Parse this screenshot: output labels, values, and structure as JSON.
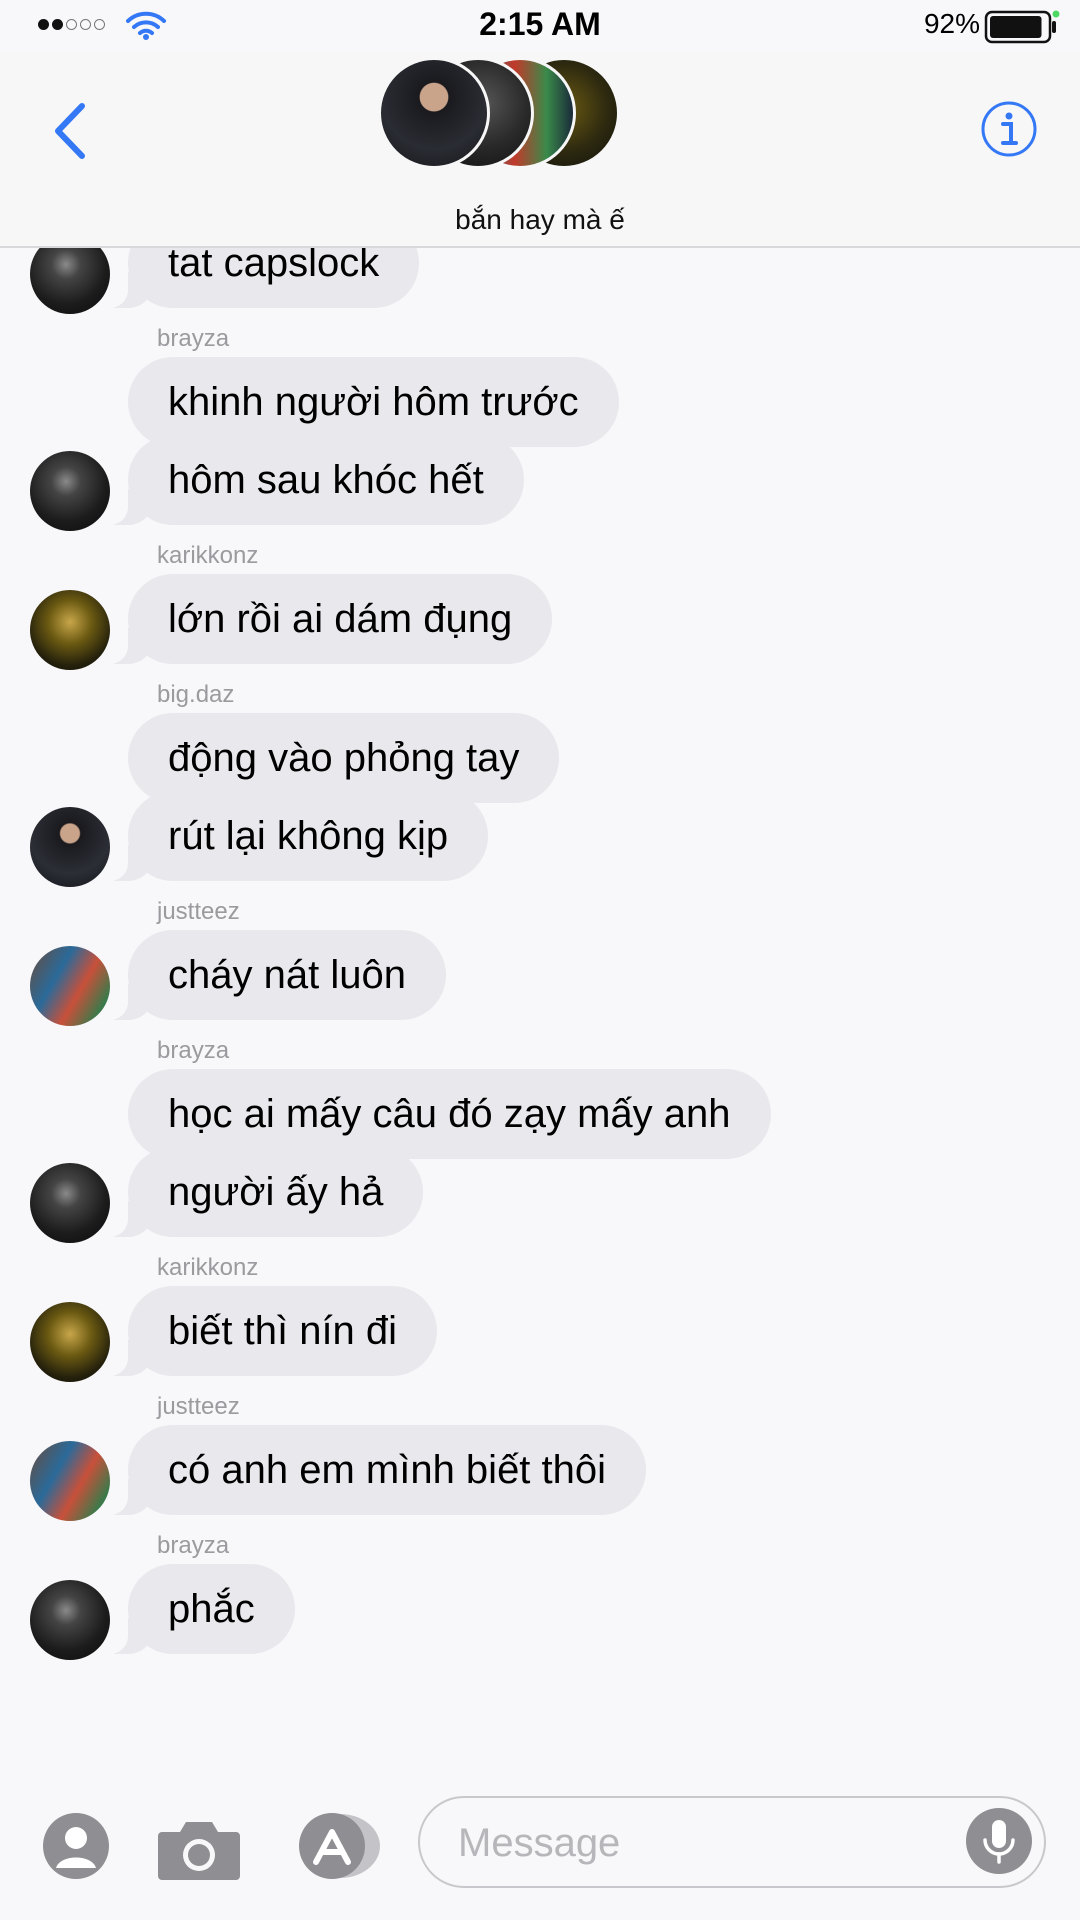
{
  "status_bar": {
    "time": "2:15 AM",
    "battery_percent": "92%",
    "battery_level": 0.92,
    "signal_bars_filled": 2,
    "signal_bars_total": 5
  },
  "header": {
    "group_title": "bắn hay mà ế"
  },
  "messages": [
    {
      "sender": "",
      "text": "tat capslock",
      "avatar": "brayza",
      "tail": true
    },
    {
      "sender": "brayza",
      "text": "khinh người hôm trước",
      "avatar": "",
      "tail": false
    },
    {
      "sender": "",
      "text": "hôm sau khóc hết",
      "avatar": "brayza",
      "tail": true
    },
    {
      "sender": "karikkonz",
      "text": "lớn rồi ai dám đụng",
      "avatar": "karikkonz",
      "tail": true
    },
    {
      "sender": "big.daz",
      "text": "động vào phỏng tay",
      "avatar": "",
      "tail": false
    },
    {
      "sender": "",
      "text": "rút lại không kịp",
      "avatar": "big.daz",
      "tail": true
    },
    {
      "sender": "justteez",
      "text": "cháy nát luôn",
      "avatar": "justteez",
      "tail": true
    },
    {
      "sender": "brayza",
      "text": "học ai mấy câu đó zạy mấy anh",
      "avatar": "",
      "tail": false
    },
    {
      "sender": "",
      "text": "người ấy hả",
      "avatar": "brayza",
      "tail": true
    },
    {
      "sender": "karikkonz",
      "text": "biết thì nín đi",
      "avatar": "karikkonz",
      "tail": true
    },
    {
      "sender": "justteez",
      "text": "có anh em mình biết thôi",
      "avatar": "justteez",
      "tail": true
    },
    {
      "sender": "brayza",
      "text": "phắc",
      "avatar": "brayza",
      "tail": true
    }
  ],
  "compose": {
    "placeholder": "Message",
    "value": ""
  },
  "icons": {
    "back": "chevron-left-icon",
    "info": "info-icon",
    "contact": "person-icon",
    "camera": "camera-icon",
    "apps": "app-store-icon",
    "mic": "microphone-icon"
  },
  "colors": {
    "accent": "#3478f6",
    "bubble": "#e8e8ed",
    "background": "#f8f8fa",
    "sender_label": "#9a9a9f"
  }
}
